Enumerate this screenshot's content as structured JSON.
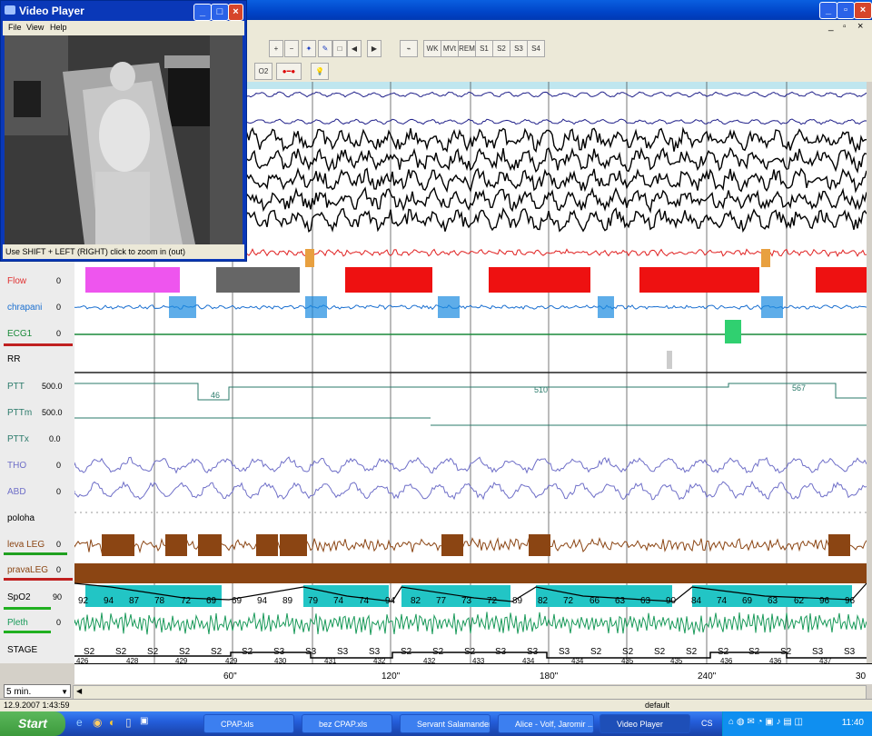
{
  "video_player": {
    "title": "Video Player",
    "menu": [
      "File",
      "View",
      "Help"
    ],
    "status_text": "Use SHIFT + LEFT (RIGHT) click to zoom in (out)"
  },
  "toolbar": {
    "row1": [
      "WK",
      "MVt",
      "REM",
      "S1",
      "S2",
      "S3",
      "S4"
    ],
    "row2_label": "O2"
  },
  "channels": [
    {
      "name": "Flow",
      "scale": "0",
      "color": "#e03030"
    },
    {
      "name": "chrapani",
      "scale": "0",
      "color": "#1a6fd0"
    },
    {
      "name": "ECG1",
      "scale": "0",
      "color": "#1a8a3a"
    },
    {
      "name": "RR",
      "scale": "",
      "color": "#000000"
    },
    {
      "name": "PTT",
      "scale": "500.0",
      "color": "#2a7a6a"
    },
    {
      "name": "PTTm",
      "scale": "500.0",
      "color": "#2a7a6a"
    },
    {
      "name": "PTTx",
      "scale": "0.0",
      "color": "#2a7a6a"
    },
    {
      "name": "THO",
      "scale": "0",
      "color": "#6f6fc8"
    },
    {
      "name": "ABD",
      "scale": "0",
      "color": "#6f6fc8"
    },
    {
      "name": "poloha",
      "scale": "",
      "color": "#000000"
    },
    {
      "name": "leva LEG",
      "scale": "0",
      "color": "#8b4513"
    },
    {
      "name": "pravaLEG",
      "scale": "0",
      "color": "#8b4513"
    },
    {
      "name": "SpO2",
      "scale": "90",
      "color": "#1ab5b5"
    },
    {
      "name": "Pleth",
      "scale": "0",
      "color": "#1a9a5a"
    },
    {
      "name": "STAGE",
      "scale": "",
      "color": "#000000"
    }
  ],
  "ptt_values": [
    "46",
    "510",
    "567"
  ],
  "spo2_values": [
    "92",
    "94",
    "87",
    "78",
    "72",
    "69",
    "69",
    "94",
    "89",
    "79",
    "74",
    "74",
    "94",
    "82",
    "77",
    "73",
    "72",
    "89",
    "82",
    "72",
    "66",
    "63",
    "63",
    "90",
    "84",
    "74",
    "69",
    "63",
    "62",
    "96",
    "96"
  ],
  "stage_labels": [
    "S2",
    "S2",
    "S2",
    "S2",
    "S2",
    "S2",
    "S3",
    "S3",
    "S3",
    "S3",
    "S2",
    "S2",
    "S2",
    "S3",
    "S3",
    "S3",
    "S2",
    "S2",
    "S2",
    "S2",
    "S2",
    "S2",
    "S2",
    "S3",
    "S3"
  ],
  "epochs": [
    "426",
    "428",
    "429",
    "429",
    "430",
    "431",
    "432",
    "432",
    "433",
    "434",
    "434",
    "435",
    "435",
    "436",
    "436",
    "437"
  ],
  "time_axis": [
    "60\"",
    "120\"",
    "180\"",
    "240\"",
    "30"
  ],
  "zoom": "5 min.",
  "status": {
    "datetime": "12.9.2007 1:43:59",
    "profile": "default"
  },
  "taskbar": {
    "start": "Start",
    "items": [
      "CPAP.xls",
      "bez CPAP.xls",
      "Servant Salamander",
      "Alice - Volf, Jaromir ...",
      "Video Player",
      "CS"
    ],
    "clock": "11:40"
  },
  "colors": {
    "flow_magenta": "#ee55ee",
    "flow_gray": "#666666",
    "flow_red": "#ee1111",
    "spo2_teal": "#22c5c5",
    "leg_brown": "#8b4513"
  }
}
